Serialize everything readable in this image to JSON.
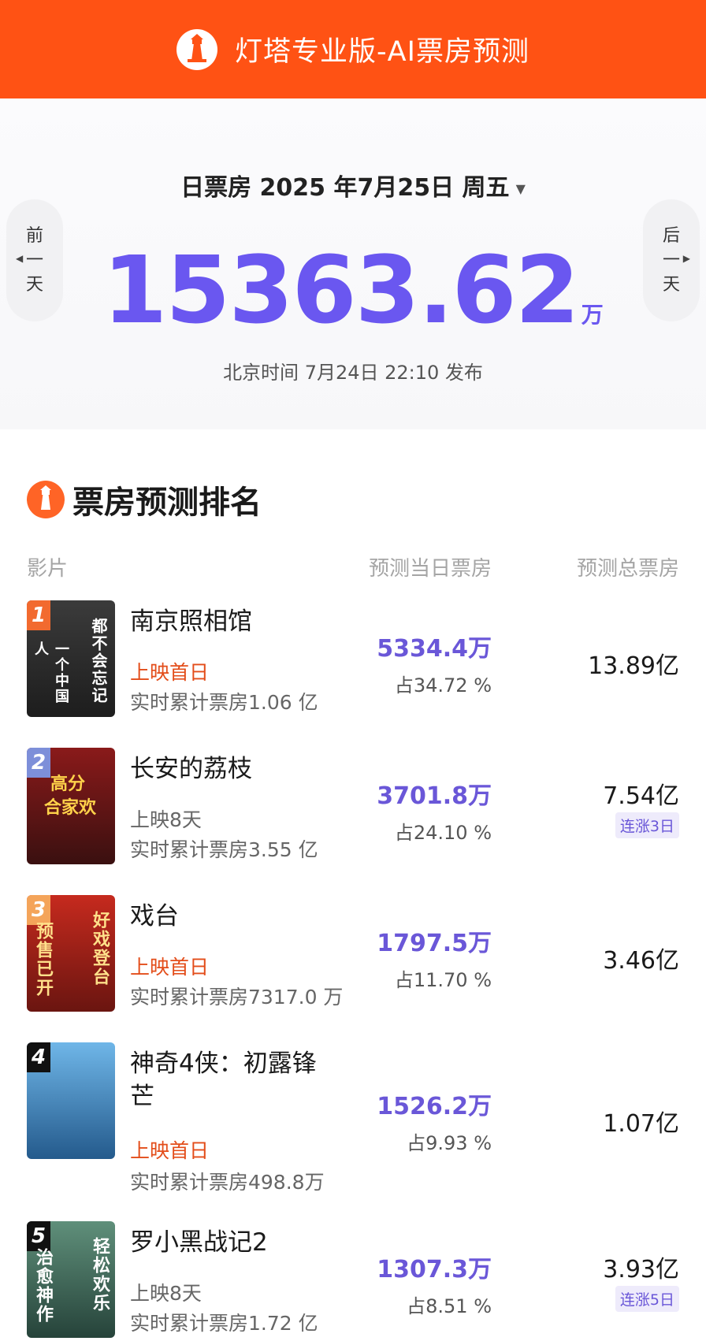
{
  "header": {
    "title": "灯塔专业版-AI票房预测",
    "logo_icon": "lighthouse-logo-icon"
  },
  "summary": {
    "date_label": "日票房 2025 年7月25日 周五",
    "prev_day": [
      "前",
      "一",
      "天"
    ],
    "next_day": [
      "后",
      "一",
      "天"
    ],
    "total_value": "15363.62",
    "total_unit": "万",
    "publish_text": "北京时间 7月24日 22:10 发布"
  },
  "ranking": {
    "title": "票房预测排名",
    "columns": {
      "film": "影片",
      "daily": "预测当日票房",
      "total": "预测总票房"
    },
    "rows": [
      {
        "rank": "1",
        "title": "南京照相馆",
        "days": "上映首日",
        "cum": "实时累计票房1.06 亿",
        "pred": "5334.4万",
        "pct": "占34.72 %",
        "total": "13.89亿",
        "streak": "",
        "badge_color": "#f26a2f",
        "poster_text_a": "都不会忘记",
        "poster_text_b": "一个中国人"
      },
      {
        "rank": "2",
        "title": "长安的荔枝",
        "days": "上映8天",
        "cum": "实时累计票房3.55 亿",
        "pred": "3701.8万",
        "pct": "占24.10 %",
        "total": "7.54亿",
        "streak": "连涨3日",
        "badge_color": "#7d8fd9",
        "poster_text_a": "高分",
        "poster_text_b": "合家欢"
      },
      {
        "rank": "3",
        "title": "戏台",
        "days": "上映首日",
        "cum": "实时累计票房7317.0 万",
        "pred": "1797.5万",
        "pct": "占11.70 %",
        "total": "3.46亿",
        "streak": "",
        "badge_color": "#f4a45a",
        "poster_text_a": "好戏登台",
        "poster_text_b": "预售已开"
      },
      {
        "rank": "4",
        "title": "神奇4侠：初露锋芒",
        "days": "上映首日",
        "cum": "实时累计票房498.8万",
        "pred": "1526.2万",
        "pct": "占9.93 %",
        "total": "1.07亿",
        "streak": "",
        "badge_color": "#111111",
        "poster_text_a": "",
        "poster_text_b": ""
      },
      {
        "rank": "5",
        "title": "罗小黑战记2",
        "days": "上映8天",
        "cum": "实时累计票房1.72 亿",
        "pred": "1307.3万",
        "pct": "占8.51 %",
        "total": "3.93亿",
        "streak": "连涨5日",
        "badge_color": "#111111",
        "poster_text_a": "轻松欢乐",
        "poster_text_b": "治愈神作"
      }
    ]
  }
}
